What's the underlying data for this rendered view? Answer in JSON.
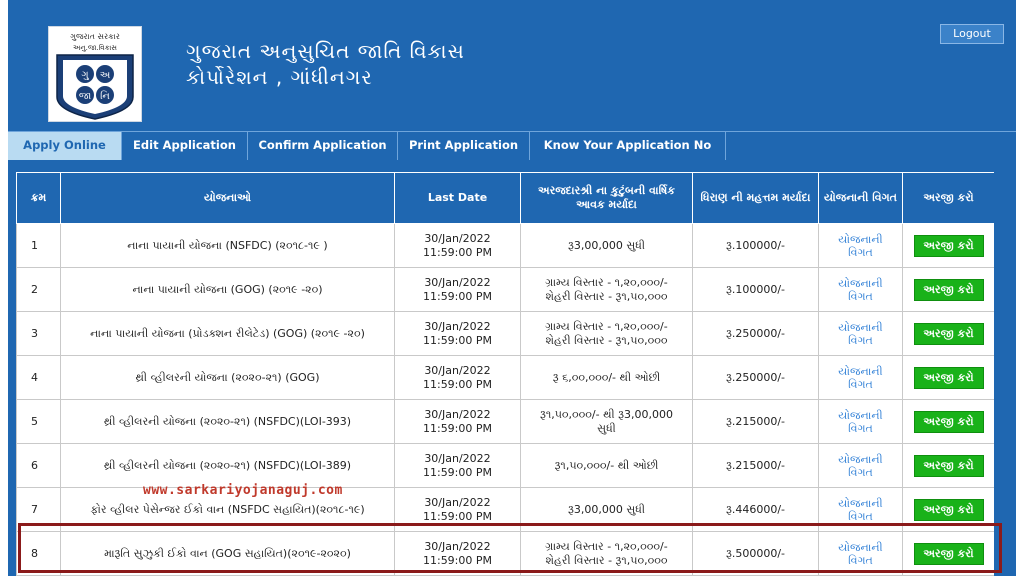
{
  "header": {
    "title_line1": "ગુજરાત અનુસુચિત જાતિ વિકાસ",
    "title_line2": "કોર્પોરેશન , ગાંધીનગર",
    "logout_label": "Logout"
  },
  "logo": {
    "top_text": "ગુજરાત સરકાર",
    "sub_text": "અનુ.જા.વિકાસ",
    "letters": [
      "ગુ",
      "અ",
      "જા",
      "નિ"
    ]
  },
  "nav": [
    {
      "label": "Apply Online",
      "active": true
    },
    {
      "label": "Edit Application",
      "active": false
    },
    {
      "label": "Confirm Application",
      "active": false
    },
    {
      "label": "Print Application",
      "active": false
    },
    {
      "label": "Know Your Application No",
      "active": false
    }
  ],
  "table": {
    "headers": [
      "ક્રમ",
      "યોજનાઓ",
      "Last Date",
      "અરજદારશ્રી ના કુટુંબની વાર્ષિક આવક મર્યાદા",
      "ધિરાણ ની મહત્તમ મર્યાદા",
      "યોજનાની વિગત",
      "અરજી કરો"
    ],
    "rows": [
      {
        "no": "1",
        "scheme": "નાના પાયાની યોજના (NSFDC) (૨૦૧૮-૧૯ )",
        "date": "30/Jan/2022",
        "time": "11:59:00 PM",
        "income1": "રૂ3,00,000 સુધી",
        "income2": "",
        "limit": "રૂ.100000/-",
        "detail1": "યોજનાની",
        "detail2": "વિગત",
        "apply": "અરજી કરો"
      },
      {
        "no": "2",
        "scheme": "નાના પાયાની યોજના (GOG) (૨૦૧૯ -૨૦)",
        "date": "30/Jan/2022",
        "time": "11:59:00 PM",
        "income1": "ગ્રામ્ય વિસ્તાર - ૧,૨૦,૦૦૦/-",
        "income2": "શેહરી વિસ્તાર - રૂ૧,૫૦,૦૦૦",
        "limit": "રૂ.100000/-",
        "detail1": "યોજનાની",
        "detail2": "વિગત",
        "apply": "અરજી કરો"
      },
      {
        "no": "3",
        "scheme": "નાના પાયાની યોજના (પ્રોડક્શન રીલેટેડ) (GOG) (૨૦૧૯ -૨૦)",
        "date": "30/Jan/2022",
        "time": "11:59:00 PM",
        "income1": "ગ્રામ્ય વિસ્તાર - ૧,૨૦,૦૦૦/-",
        "income2": "શેહરી વિસ્તાર - રૂ૧,૫૦,૦૦૦",
        "limit": "રૂ.250000/-",
        "detail1": "યોજનાની",
        "detail2": "વિગત",
        "apply": "અરજી કરો"
      },
      {
        "no": "4",
        "scheme": "થ્રી વ્હીલરની યોજના (૨૦૨૦-૨૧) (GOG)",
        "date": "30/Jan/2022",
        "time": "11:59:00 PM",
        "income1": "રૂ ૬,૦૦,૦૦૦/- થી ઓછી",
        "income2": "",
        "limit": "રૂ.250000/-",
        "detail1": "યોજનાની",
        "detail2": "વિગત",
        "apply": "અરજી કરો"
      },
      {
        "no": "5",
        "scheme": "થ્રી વ્હીલરની યોજના (૨૦૨૦-૨૧) (NSFDC)(LOI-393)",
        "date": "30/Jan/2022",
        "time": "11:59:00 PM",
        "income1": "રૂ૧,૫૦,૦૦૦/- થી રૂ3,00,000",
        "income2": "સુધી",
        "limit": "રૂ.215000/-",
        "detail1": "યોજનાની",
        "detail2": "વિગત",
        "apply": "અરજી કરો"
      },
      {
        "no": "6",
        "scheme": "થ્રી વ્હીલરની યોજના (૨૦૨૦-૨૧) (NSFDC)(LOI-389)",
        "date": "30/Jan/2022",
        "time": "11:59:00 PM",
        "income1": "રૂ૧,૫૦,૦૦૦/- થી ઓછી",
        "income2": "",
        "limit": "રૂ.215000/-",
        "detail1": "યોજનાની",
        "detail2": "વિગત",
        "apply": "અરજી કરો"
      },
      {
        "no": "7",
        "scheme": "ફોર વ્હીલર પેસેન્જર ઈકો વાન (NSFDC સહાયિત)(૨૦૧૮-૧૯)",
        "date": "30/Jan/2022",
        "time": "11:59:00 PM",
        "income1": "રૂ3,00,000 સુધી",
        "income2": "",
        "limit": "રૂ.446000/-",
        "detail1": "યોજનાની",
        "detail2": "વિગત",
        "apply": "અરજી કરો"
      },
      {
        "no": "8",
        "scheme": "મારૂતિ સુઝુકી ઈકો વાન (GOG સહાયિત)(૨૦૧૯-૨૦૨૦)",
        "date": "30/Jan/2022",
        "time": "11:59:00 PM",
        "income1": "ગ્રામ્ય વિસ્તાર - ૧,૨૦,૦૦૦/-",
        "income2": "શેહરી વિસ્તાર - રૂ૧,૫૦,૦૦૦",
        "limit": "રૂ.500000/-",
        "detail1": "યોજનાની",
        "detail2": "વિગત",
        "apply": "અરજી કરો"
      }
    ]
  },
  "watermark": "www.sarkariyojanaguj.com",
  "colors": {
    "primary": "#1f67b1",
    "nav_active_bg": "#b9dbf2",
    "apply_green": "#19b219",
    "highlight": "#8b1a1a",
    "watermark": "#c0392b",
    "link": "#2f7fd6"
  }
}
